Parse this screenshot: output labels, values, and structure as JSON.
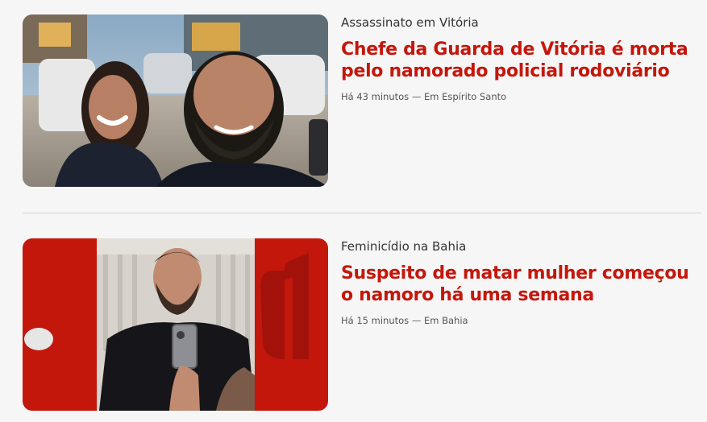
{
  "feed": {
    "items": [
      {
        "kicker": "Assassinato em Vitória",
        "headline": "Chefe da Guarda de Vitória é morta pelo namorado policial rodoviário",
        "time": "Há 43 minutos",
        "separator": "—",
        "section": "Em Espírito Santo",
        "image_alt": "Selfie de casal sorrindo em estacionamento"
      },
      {
        "kicker": "Feminicídio na Bahia",
        "headline": "Suspeito de matar mulher começou o namoro há uma semana",
        "time": "Há 15 minutos",
        "separator": "—",
        "section": "Em Bahia",
        "image_alt": "Homem barbudo tirando selfie no espelho com fundo vermelho"
      }
    ]
  },
  "colors": {
    "headline": "#c4170c",
    "kicker": "#333333",
    "meta": "#555555",
    "background": "#f6f6f6",
    "brand_red": "#c4170c"
  }
}
